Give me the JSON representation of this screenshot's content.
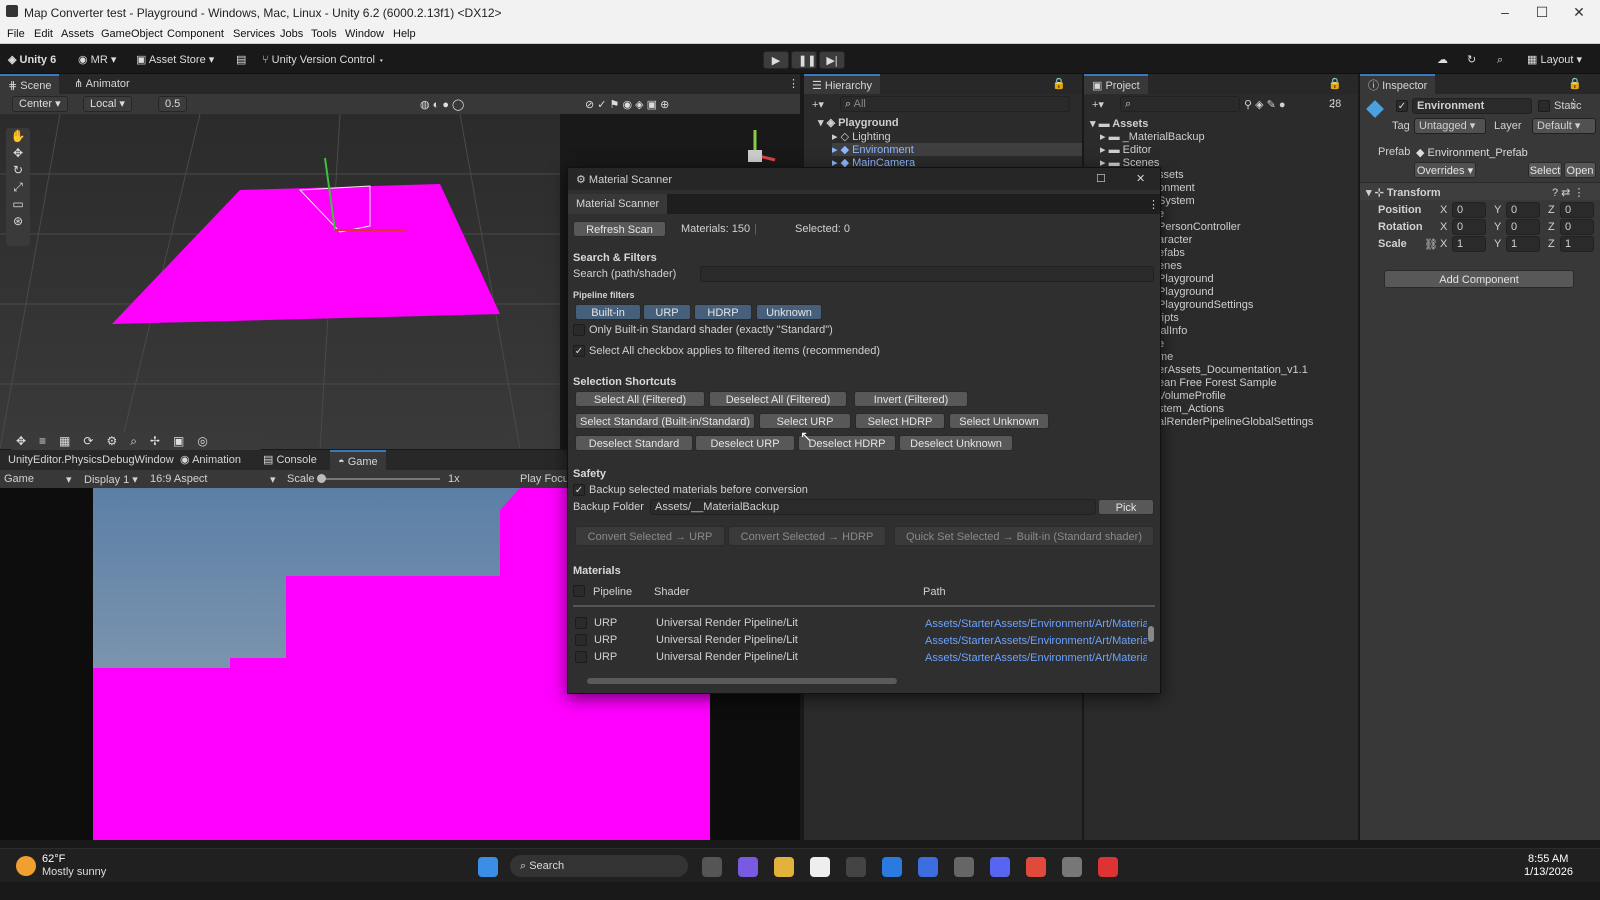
{
  "window": {
    "title": "Map Converter test - Playground - Windows, Mac, Linux - Unity 6.2 (6000.2.13f1) <DX12>"
  },
  "menu": [
    "File",
    "Edit",
    "Assets",
    "GameObject",
    "Component",
    "Services",
    "Jobs",
    "Tools",
    "Window",
    "Help"
  ],
  "toolbar": {
    "unity": "Unity 6",
    "account": "MR",
    "asset_store": "Asset Store",
    "version_control": "Unity Version Control",
    "layout": "Layout"
  },
  "scene": {
    "tabs": [
      "Scene",
      "Animator"
    ],
    "pivot": "Center",
    "space": "Local",
    "snap": "0.5"
  },
  "game": {
    "tabs": [
      "UnityEditor.PhysicsDebugWindow",
      "Animation",
      "Console",
      "Game"
    ],
    "mode": "Game",
    "display": "Display 1",
    "aspect": "16:9 Aspect",
    "scale_label": "Scale",
    "scale_value": "1x",
    "play_focus": "Play Focu"
  },
  "hierarchy": {
    "title": "Hierarchy",
    "search": "All",
    "root": "Playground",
    "items": [
      "Lighting",
      "Environment",
      "MainCamera"
    ]
  },
  "project": {
    "title": "Project",
    "count": "28",
    "root": "Assets",
    "folders": [
      "_MaterialBackup",
      "Editor",
      "Scenes"
    ],
    "items": [
      "ssets",
      "onment",
      "System",
      "e",
      "PersonController",
      "aracter",
      "efabs",
      "enes",
      "Playground",
      "Playground",
      "PlaygroundSettings",
      "ripts",
      "ialInfo",
      "e",
      "me",
      "erAssets_Documentation_v1.1",
      "ean Free Forest Sample",
      "VolumeProfile",
      "stem_Actions",
      "alRenderPipelineGlobalSettings"
    ]
  },
  "inspector": {
    "title": "Inspector",
    "object": "Environment",
    "static": "Static",
    "tag_label": "Tag",
    "tag": "Untagged",
    "layer_label": "Layer",
    "layer": "Default",
    "prefab_label": "Prefab",
    "prefab": "Environment_Prefab",
    "overrides": "Overrides",
    "select": "Select",
    "open": "Open",
    "transform": "Transform",
    "rows": [
      {
        "label": "Position",
        "x": "0",
        "y": "0",
        "z": "0"
      },
      {
        "label": "Rotation",
        "x": "0",
        "y": "0",
        "z": "0"
      },
      {
        "label": "Scale",
        "x": "1",
        "y": "1",
        "z": "1"
      }
    ],
    "add_component": "Add Component"
  },
  "scanner": {
    "title": "Material Scanner",
    "tab": "Material Scanner",
    "refresh": "Refresh Scan",
    "materials": "Materials: 150",
    "selected": "Selected: 0",
    "search_filters": "Search & Filters",
    "search_label": "Search (path/shader)",
    "pipeline_filters": "Pipeline filters",
    "filters": [
      "Built-in",
      "URP",
      "HDRP",
      "Unknown"
    ],
    "only_builtin": "Only Built-in Standard shader (exactly \"Standard\")",
    "select_all_note": "Select All checkbox applies to filtered items (recommended)",
    "shortcuts_title": "Selection Shortcuts",
    "row1": [
      "Select All (Filtered)",
      "Deselect All (Filtered)",
      "Invert (Filtered)"
    ],
    "row2": [
      "Select Standard (Built-in/Standard)",
      "Select URP",
      "Select HDRP",
      "Select Unknown"
    ],
    "row3": [
      "Deselect Standard",
      "Deselect URP",
      "Deselect HDRP",
      "Deselect Unknown"
    ],
    "safety": "Safety",
    "backup_label": "Backup selected materials before conversion",
    "backup_folder_label": "Backup Folder",
    "backup_folder": "Assets/__MaterialBackup",
    "pick": "Pick",
    "convert_urp": "Convert Selected → URP",
    "convert_hdrp": "Convert Selected → HDRP",
    "quick_set": "Quick Set Selected → Built-in (Standard shader)",
    "materials_title": "Materials",
    "columns": [
      "Pipeline",
      "Shader",
      "Path"
    ],
    "rows": [
      {
        "pipeline": "URP",
        "shader": "Universal Render Pipeline/Lit",
        "path": "Assets/StarterAssets/Environment/Art/Materia"
      },
      {
        "pipeline": "URP",
        "shader": "Universal Render Pipeline/Lit",
        "path": "Assets/StarterAssets/Environment/Art/Materia"
      },
      {
        "pipeline": "URP",
        "shader": "Universal Render Pipeline/Lit",
        "path": "Assets/StarterAssets/Environment/Art/Materia"
      }
    ]
  },
  "taskbar": {
    "temp": "62°F",
    "weather": "Mostly sunny",
    "search": "Search",
    "time": "8:55 AM",
    "date": "1/13/2026"
  }
}
